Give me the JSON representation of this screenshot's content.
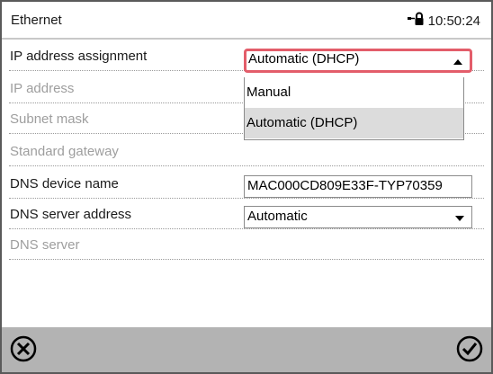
{
  "header": {
    "title": "Ethernet",
    "time": "10:50:24"
  },
  "rows": [
    {
      "label": "IP address assignment",
      "enabled": true
    },
    {
      "label": "IP address",
      "enabled": false
    },
    {
      "label": "Subnet mask",
      "enabled": false
    },
    {
      "label": "Standard gateway",
      "enabled": false
    },
    {
      "label": "DNS device name",
      "enabled": true
    },
    {
      "label": "DNS server  address",
      "enabled": true
    },
    {
      "label": "DNS server",
      "enabled": false
    }
  ],
  "ip_assignment": {
    "value": "Automatic (DHCP)",
    "options": [
      "Manual",
      "Automatic (DHCP)"
    ]
  },
  "dns_device_name": {
    "value": "MAC000CD809E33F-TYP70359"
  },
  "dns_server_address": {
    "value": "Automatic"
  },
  "icons": {
    "header": "network-lock-icon",
    "cancel": "close-circle-icon",
    "confirm": "check-circle-icon"
  },
  "colors": {
    "focus_border": "#e35d6a",
    "footer": "#b3b3b3",
    "selected_option": "#dcdcdc"
  }
}
